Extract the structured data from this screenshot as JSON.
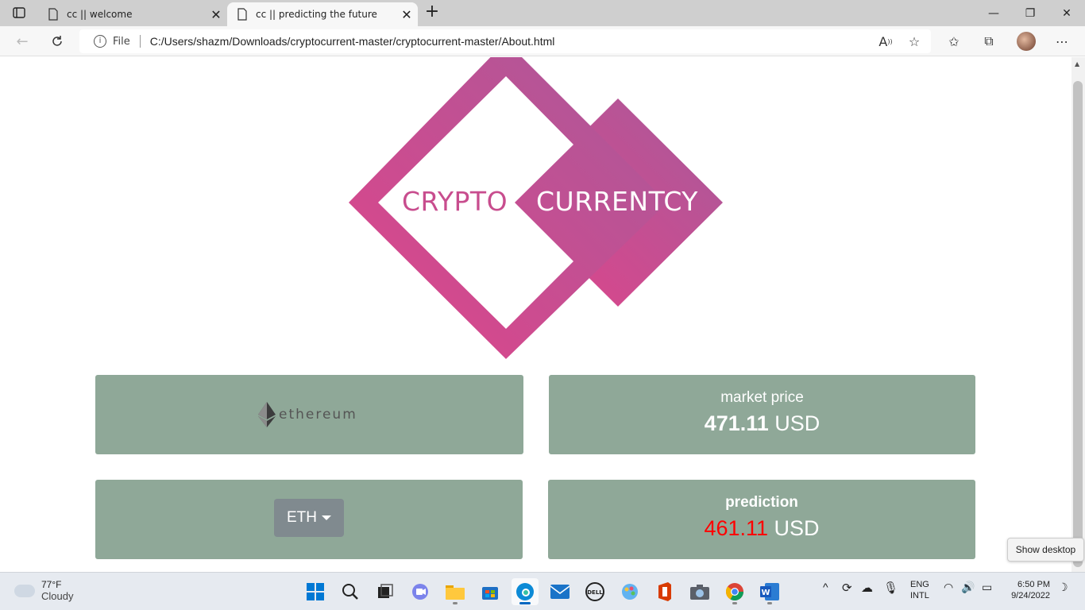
{
  "browser": {
    "tabs": [
      {
        "title": "cc || welcome",
        "active": false
      },
      {
        "title": "cc || predicting the future",
        "active": true
      }
    ],
    "address": {
      "scheme": "File",
      "url": "C:/Users/shazm/Downloads/cryptocurrent-master/cryptocurrent-master/About.html"
    }
  },
  "page": {
    "logo": {
      "left_text": "CRYPTO",
      "right_text": "CURRENTCY"
    },
    "coin_card": {
      "logo_text": "ethereum"
    },
    "market_card": {
      "label": "market price",
      "price": "471.11",
      "currency": "USD"
    },
    "select_card": {
      "selected": "ETH"
    },
    "prediction_card": {
      "label": "prediction",
      "price": "461.11",
      "currency": "USD"
    }
  },
  "tooltip": "Show desktop",
  "taskbar": {
    "weather": {
      "temp": "77°F",
      "condition": "Cloudy"
    },
    "tray": {
      "lang": "ENG",
      "layout": "INTL",
      "time": "6:50 PM",
      "date": "9/24/2022"
    }
  },
  "colors": {
    "logo_pink": "#d3468a",
    "logo_purple": "#a85a9a",
    "card_bg": "#8fa898",
    "prediction_red": "#ff0000"
  }
}
